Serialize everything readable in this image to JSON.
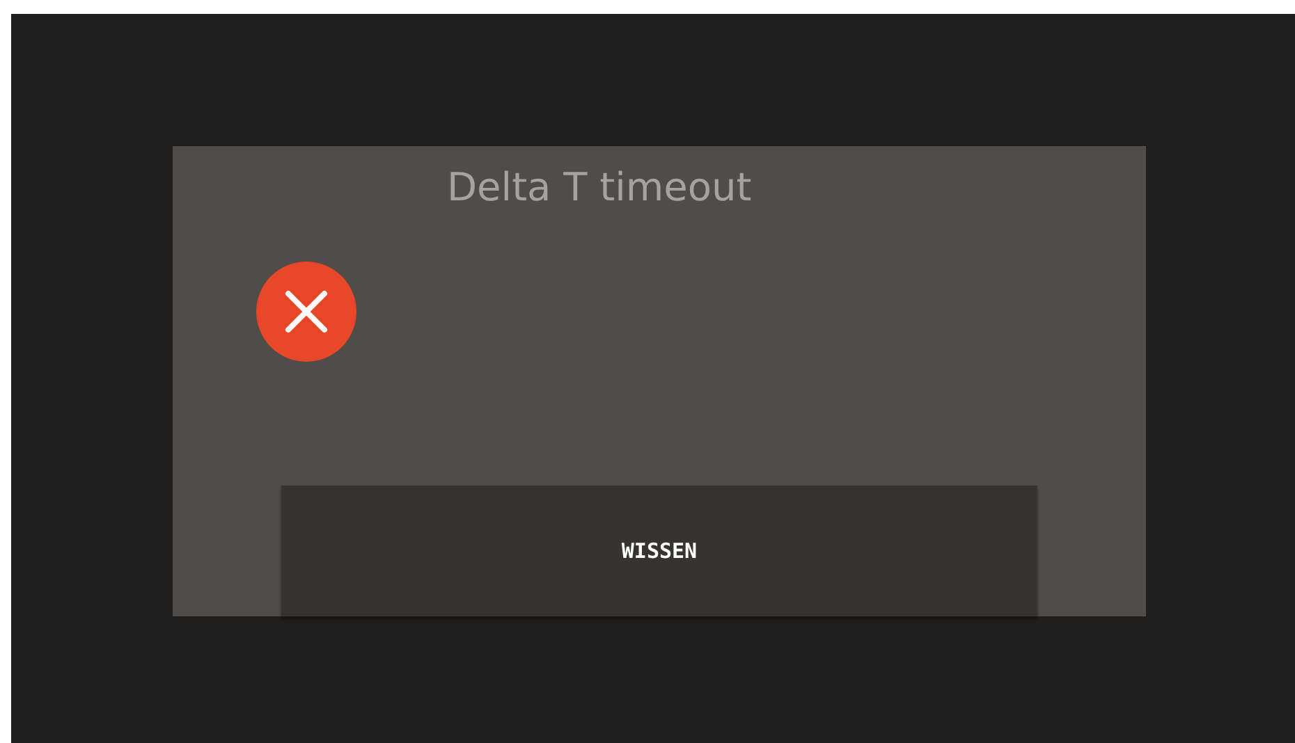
{
  "dialog": {
    "title": "Delta T timeout",
    "kind": "error",
    "button": "WISSEN"
  }
}
